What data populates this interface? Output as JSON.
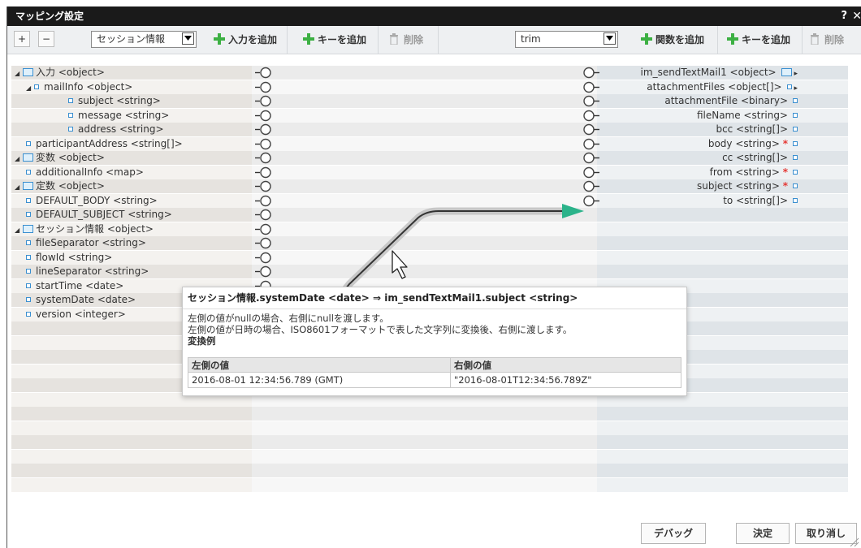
{
  "dialog": {
    "title": "マッピング設定",
    "help": "?",
    "close": "✕"
  },
  "toolbar": {
    "expand": "+",
    "collapse": "−",
    "left_select": "セッション情報",
    "add_input": "入力を追加",
    "add_key_left": "キーを追加",
    "delete_left": "削除",
    "func_select": "trim",
    "add_function": "関数を追加",
    "add_key_right": "キーを追加",
    "delete_right": "削除"
  },
  "left_tree": [
    {
      "label": "入力 <object>",
      "kind": "object",
      "indent": 0,
      "expanded": true
    },
    {
      "label": "mailInfo <object>",
      "kind": "leaf",
      "indent": 1,
      "expanded": true
    },
    {
      "label": "subject <string>",
      "kind": "leaf",
      "indent": 2
    },
    {
      "label": "message <string>",
      "kind": "leaf",
      "indent": 2
    },
    {
      "label": "address <string>",
      "kind": "leaf",
      "indent": 2
    },
    {
      "label": "participantAddress <string[]>",
      "kind": "leaf",
      "indent": 1
    },
    {
      "label": "変数 <object>",
      "kind": "object",
      "indent": 0,
      "expanded": true
    },
    {
      "label": "additionalInfo <map>",
      "kind": "leaf",
      "indent": 1
    },
    {
      "label": "定数 <object>",
      "kind": "object",
      "indent": 0,
      "expanded": true
    },
    {
      "label": "DEFAULT_BODY <string>",
      "kind": "leaf",
      "indent": 1
    },
    {
      "label": "DEFAULT_SUBJECT <string>",
      "kind": "leaf",
      "indent": 1
    },
    {
      "label": "セッション情報 <object>",
      "kind": "object",
      "indent": 0,
      "expanded": true
    },
    {
      "label": "fileSeparator <string>",
      "kind": "leaf",
      "indent": 1
    },
    {
      "label": "flowId <string>",
      "kind": "leaf",
      "indent": 1
    },
    {
      "label": "lineSeparator <string>",
      "kind": "leaf",
      "indent": 1
    },
    {
      "label": "startTime <date>",
      "kind": "leaf",
      "indent": 1
    },
    {
      "label": "systemDate <date>",
      "kind": "leaf",
      "indent": 1
    },
    {
      "label": "version <integer>",
      "kind": "leaf",
      "indent": 1
    }
  ],
  "right_tree": [
    {
      "label": "im_sendTextMail1 <object>",
      "kind": "object",
      "required": false,
      "expanded": true
    },
    {
      "label": "attachmentFiles <object[]>",
      "kind": "leaf",
      "required": false,
      "expanded": true
    },
    {
      "label": "attachmentFile <binary>",
      "kind": "leaf",
      "required": false
    },
    {
      "label": "fileName <string>",
      "kind": "leaf",
      "required": false
    },
    {
      "label": "bcc <string[]>",
      "kind": "leaf",
      "required": false
    },
    {
      "label": "body <string>",
      "kind": "leaf",
      "required": true
    },
    {
      "label": "cc <string[]>",
      "kind": "leaf",
      "required": false
    },
    {
      "label": "from <string>",
      "kind": "leaf",
      "required": true
    },
    {
      "label": "subject <string>",
      "kind": "leaf",
      "required": true
    },
    {
      "label": "to <string[]>",
      "kind": "leaf",
      "required": false
    }
  ],
  "required_mark": "*",
  "tooltip": {
    "heading": "セッション情報.systemDate <date> ⇒ im_sendTextMail1.subject <string>",
    "line1": "左側の値がnullの場合、右側にnullを渡します。",
    "line2": "左側の値が日時の場合、ISO8601フォーマットで表した文字列に変換後、右側に渡します。",
    "example_label": "変換例",
    "col_left": "左側の値",
    "col_right": "右側の値",
    "row_left": "2016-08-01 12:34:56.789 (GMT)",
    "row_right": "\"2016-08-01T12:34:56.789Z\""
  },
  "footer": {
    "debug": "デバッグ",
    "ok": "決定",
    "cancel": "取り消し"
  },
  "colors": {
    "connector_arrow": "#2bb38a",
    "object_icon": "#3a8fd0",
    "required": "#e53935",
    "add_icon": "#3cb043"
  }
}
